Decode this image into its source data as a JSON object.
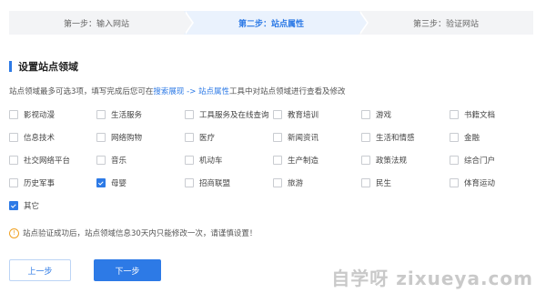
{
  "steps": [
    {
      "label": "第一步：输入网站",
      "active": false
    },
    {
      "label": "第二步：站点属性",
      "active": true
    },
    {
      "label": "第三步：验证网站",
      "active": false
    }
  ],
  "section_title": "设置站点领域",
  "description": {
    "prefix": "站点领域最多可选3项，填写完成后您可在",
    "link1": "搜索展现",
    "arrow": " -> ",
    "link2": "站点属性",
    "suffix": "工具中对站点领域进行查看及修改"
  },
  "categories": [
    {
      "label": "影视动漫",
      "checked": false
    },
    {
      "label": "生活服务",
      "checked": false
    },
    {
      "label": "工具服务及在线查询",
      "checked": false
    },
    {
      "label": "教育培训",
      "checked": false
    },
    {
      "label": "游戏",
      "checked": false
    },
    {
      "label": "书籍文档",
      "checked": false
    },
    {
      "label": "信息技术",
      "checked": false
    },
    {
      "label": "网络购物",
      "checked": false
    },
    {
      "label": "医疗",
      "checked": false
    },
    {
      "label": "新闻资讯",
      "checked": false
    },
    {
      "label": "生活和情感",
      "checked": false
    },
    {
      "label": "金融",
      "checked": false
    },
    {
      "label": "社交网络平台",
      "checked": false
    },
    {
      "label": "音乐",
      "checked": false
    },
    {
      "label": "机动车",
      "checked": false
    },
    {
      "label": "生产制造",
      "checked": false
    },
    {
      "label": "政策法规",
      "checked": false
    },
    {
      "label": "综合门户",
      "checked": false
    },
    {
      "label": "历史军事",
      "checked": false
    },
    {
      "label": "母婴",
      "checked": true
    },
    {
      "label": "招商联盟",
      "checked": false
    },
    {
      "label": "旅游",
      "checked": false
    },
    {
      "label": "民生",
      "checked": false
    },
    {
      "label": "体育运动",
      "checked": false
    },
    {
      "label": "其它",
      "checked": true
    }
  ],
  "notice": "站点验证成功后，站点领域信息30天内只能修改一次，请谨慎设置！",
  "buttons": {
    "prev": "上一步",
    "next": "下一步"
  },
  "watermark": "自学呀 zixueya.com",
  "colors": {
    "accent": "#2d7ae6",
    "step_active_bg": "#eaf2fd",
    "step_bg": "#f3f4f6"
  }
}
